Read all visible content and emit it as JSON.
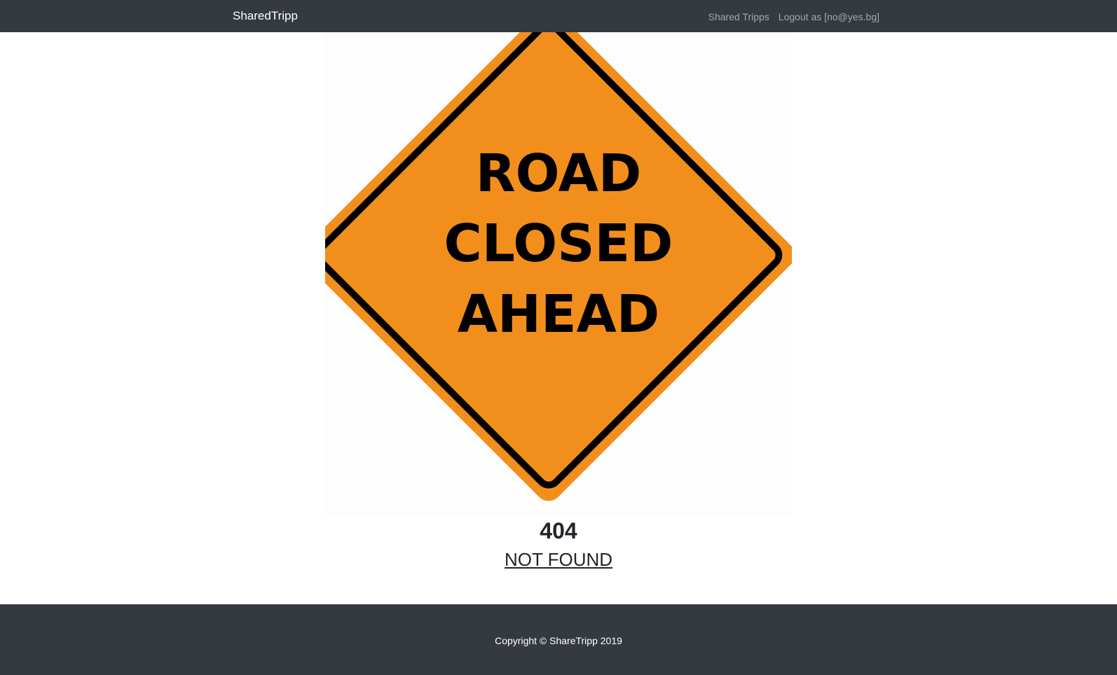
{
  "navbar": {
    "brand": "SharedTripp",
    "links": [
      {
        "label": "Shared Tripps"
      },
      {
        "label": "Logout as [no@yes.bg]"
      }
    ]
  },
  "sign": {
    "lines": [
      "ROAD",
      "CLOSED",
      "AHEAD"
    ],
    "fill_color": "#f28f1c",
    "border_color": "#000000"
  },
  "error": {
    "code": "404",
    "message": "NOT FOUND"
  },
  "footer": {
    "copyright": "Copyright © ShareTripp 2019"
  }
}
